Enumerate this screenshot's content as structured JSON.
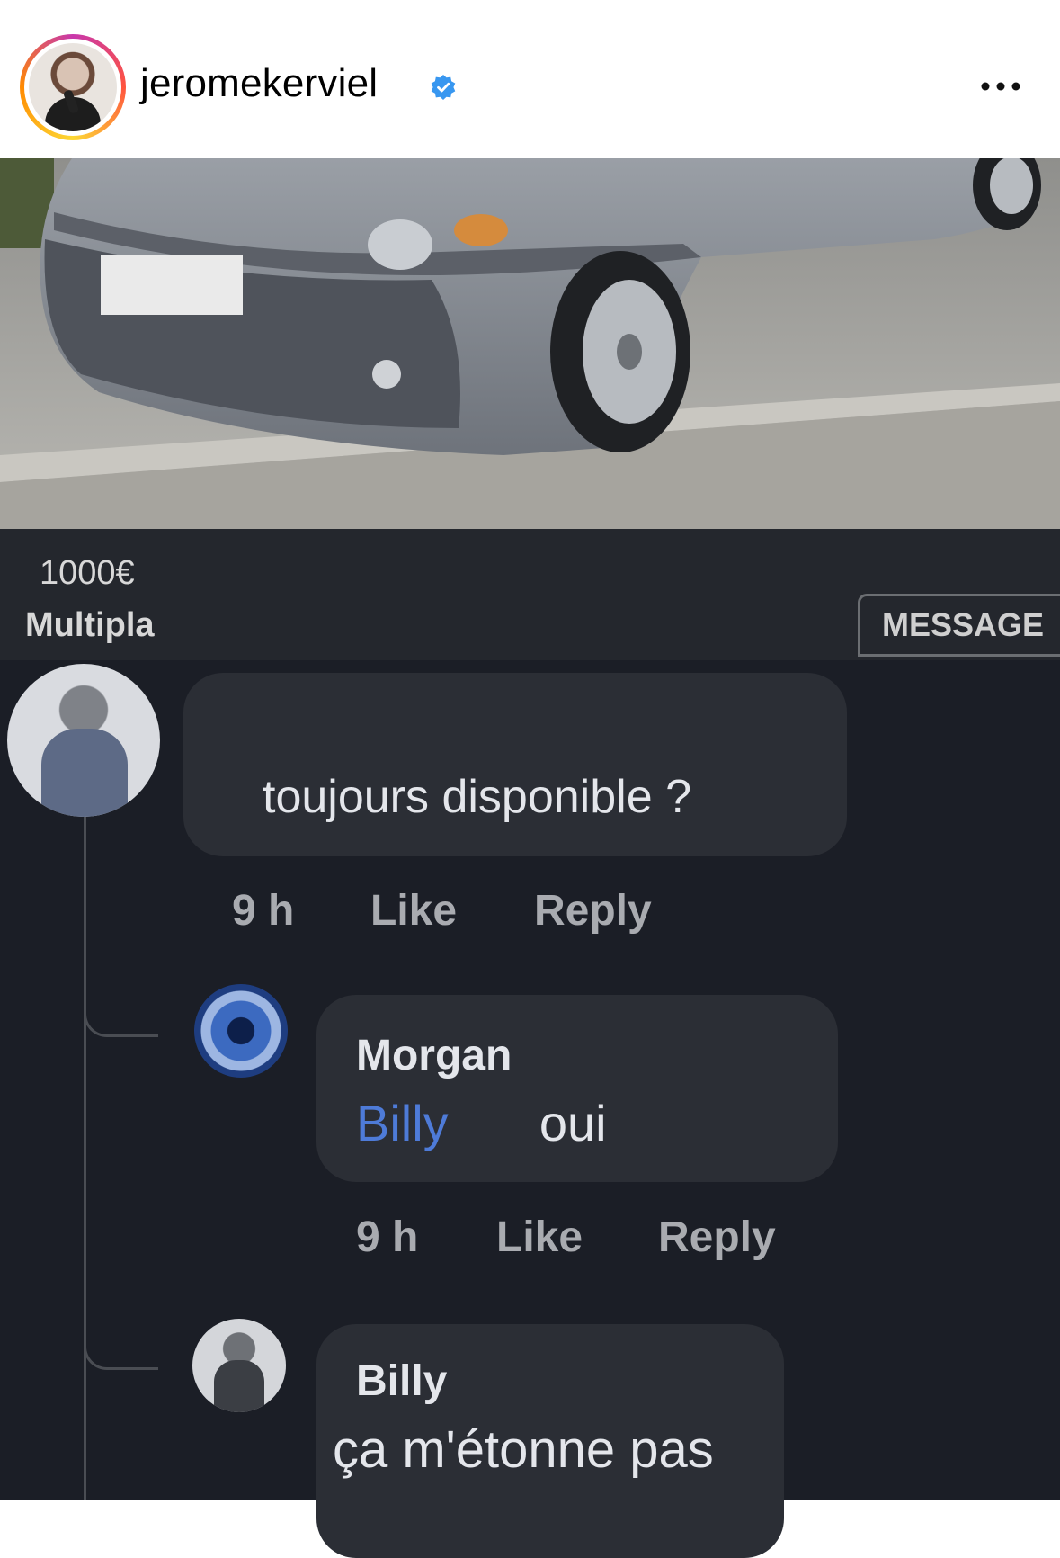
{
  "header": {
    "username": "jeromekerviel",
    "verified_icon": "verified-badge-icon",
    "more_icon": "more-options-icon"
  },
  "listing": {
    "price": "1000€",
    "model": "Multipla",
    "message_button": "MESSAGE"
  },
  "comments": [
    {
      "text": "toujours disponible ?",
      "time": "9 h",
      "like": "Like",
      "reply": "Reply"
    },
    {
      "author": "Morgan",
      "mention": "Billy",
      "text": "oui",
      "time": "9 h",
      "like": "Like",
      "reply": "Reply"
    },
    {
      "author": "Billy",
      "text": "ça m'étonne pas"
    }
  ],
  "colors": {
    "verified": "#3897f0",
    "mention": "#4e7bd8",
    "comment_bg": "#1b1e26",
    "bubble_bg": "#2b2e35"
  }
}
